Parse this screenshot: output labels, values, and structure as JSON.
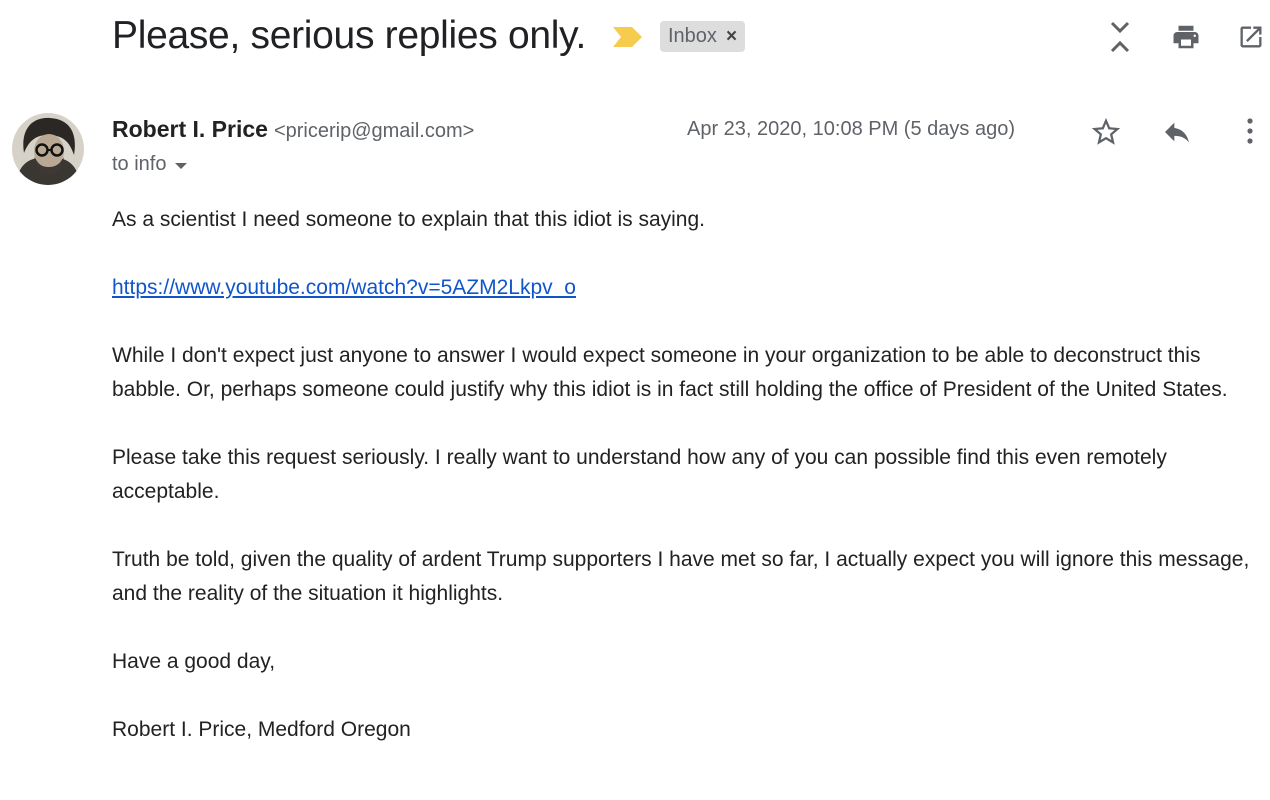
{
  "thread": {
    "subject": "Please, serious replies only.",
    "label": "Inbox",
    "label_remove_glyph": "×"
  },
  "toolbar": {
    "icons": [
      "expand-collapse-icon",
      "print-icon",
      "open-in-new-window-icon"
    ]
  },
  "message": {
    "sender_name": "Robert I. Price",
    "sender_email": "<pricerip@gmail.com>",
    "recipients": "to info",
    "date": "Apr 23, 2020, 10:08 PM (5 days ago)",
    "actions": [
      "star-icon",
      "reply-icon",
      "more-vert-icon"
    ],
    "body": {
      "p1": "As a scientist I need someone to explain that this idiot is saying.",
      "link": "https://www.youtube.com/watch?v=5AZM2Lkpv_o",
      "p2": "While I don't expect just anyone to answer I would expect someone in your organization to be able to deconstruct this babble. Or, perhaps someone could justify why this idiot is in fact still holding the office of President of the United States.",
      "p3": "Please take this request seriously. I really want to understand how any of you can possible find this even remotely acceptable.",
      "p4": "Truth be told, given the quality of ardent Trump supporters I have met so far, I actually expect you will ignore this message, and the reality of the situation it highlights.",
      "p5": "Have a good day,",
      "signature": "Robert I. Price, Medford Oregon"
    }
  },
  "colors": {
    "link": "#1155cc",
    "importance_marker": "#f7cb4d",
    "label_bg": "#dddddd",
    "secondary_text": "#5f6368"
  }
}
